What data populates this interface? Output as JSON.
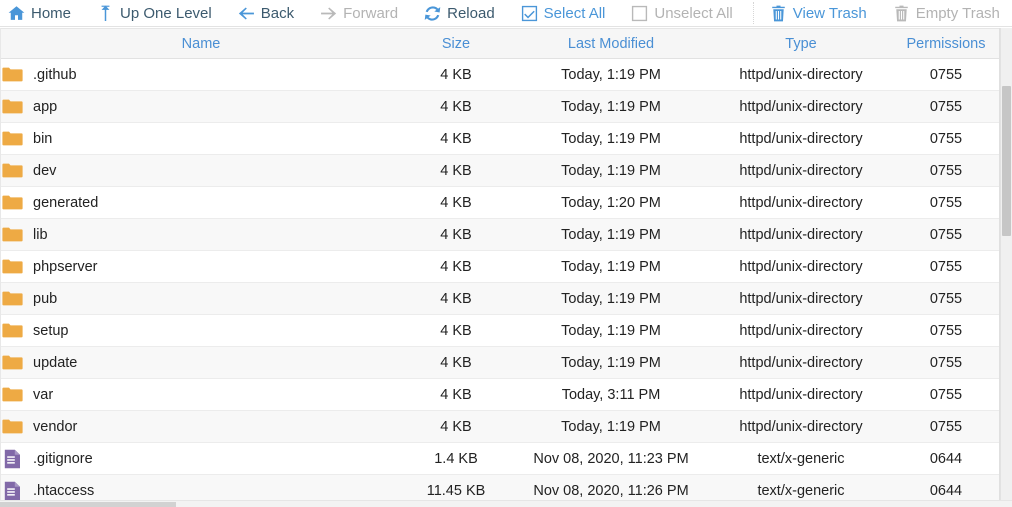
{
  "toolbar": {
    "items": [
      {
        "label": "Home",
        "icon": "home-icon",
        "state": "active"
      },
      {
        "label": "Up One Level",
        "icon": "arrow-up-icon",
        "state": "active"
      },
      {
        "label": "Back",
        "icon": "arrow-left-icon",
        "state": "active"
      },
      {
        "label": "Forward",
        "icon": "arrow-right-icon",
        "state": "disabled"
      },
      {
        "label": "Reload",
        "icon": "refresh-icon",
        "state": "active"
      },
      {
        "label": "Select All",
        "icon": "checkbox-checked-icon",
        "state": "linkblue"
      },
      {
        "label": "Unselect All",
        "icon": "checkbox-empty-icon",
        "state": "disabled"
      },
      {
        "label": "View Trash",
        "icon": "trash-icon",
        "state": "linkblue"
      },
      {
        "label": "Empty Trash",
        "icon": "trash-icon",
        "state": "disabled"
      }
    ],
    "divider_after_index": 6
  },
  "columns": [
    {
      "key": "name",
      "label": "Name"
    },
    {
      "key": "size",
      "label": "Size"
    },
    {
      "key": "modified",
      "label": "Last Modified"
    },
    {
      "key": "type",
      "label": "Type"
    },
    {
      "key": "permissions",
      "label": "Permissions"
    }
  ],
  "rows": [
    {
      "icon": "folder-icon",
      "name": ".github",
      "size": "4 KB",
      "modified": "Today, 1:19 PM",
      "type": "httpd/unix-directory",
      "permissions": "0755"
    },
    {
      "icon": "folder-icon",
      "name": "app",
      "size": "4 KB",
      "modified": "Today, 1:19 PM",
      "type": "httpd/unix-directory",
      "permissions": "0755"
    },
    {
      "icon": "folder-icon",
      "name": "bin",
      "size": "4 KB",
      "modified": "Today, 1:19 PM",
      "type": "httpd/unix-directory",
      "permissions": "0755"
    },
    {
      "icon": "folder-icon",
      "name": "dev",
      "size": "4 KB",
      "modified": "Today, 1:19 PM",
      "type": "httpd/unix-directory",
      "permissions": "0755"
    },
    {
      "icon": "folder-icon",
      "name": "generated",
      "size": "4 KB",
      "modified": "Today, 1:20 PM",
      "type": "httpd/unix-directory",
      "permissions": "0755"
    },
    {
      "icon": "folder-icon",
      "name": "lib",
      "size": "4 KB",
      "modified": "Today, 1:19 PM",
      "type": "httpd/unix-directory",
      "permissions": "0755"
    },
    {
      "icon": "folder-icon",
      "name": "phpserver",
      "size": "4 KB",
      "modified": "Today, 1:19 PM",
      "type": "httpd/unix-directory",
      "permissions": "0755"
    },
    {
      "icon": "folder-icon",
      "name": "pub",
      "size": "4 KB",
      "modified": "Today, 1:19 PM",
      "type": "httpd/unix-directory",
      "permissions": "0755"
    },
    {
      "icon": "folder-icon",
      "name": "setup",
      "size": "4 KB",
      "modified": "Today, 1:19 PM",
      "type": "httpd/unix-directory",
      "permissions": "0755"
    },
    {
      "icon": "folder-icon",
      "name": "update",
      "size": "4 KB",
      "modified": "Today, 1:19 PM",
      "type": "httpd/unix-directory",
      "permissions": "0755"
    },
    {
      "icon": "folder-icon",
      "name": "var",
      "size": "4 KB",
      "modified": "Today, 3:11 PM",
      "type": "httpd/unix-directory",
      "permissions": "0755"
    },
    {
      "icon": "folder-icon",
      "name": "vendor",
      "size": "4 KB",
      "modified": "Today, 1:19 PM",
      "type": "httpd/unix-directory",
      "permissions": "0755"
    },
    {
      "icon": "file-icon",
      "name": ".gitignore",
      "size": "1.4 KB",
      "modified": "Nov 08, 2020, 11:23 PM",
      "type": "text/x-generic",
      "permissions": "0644"
    },
    {
      "icon": "file-icon",
      "name": ".htaccess",
      "size": "11.45 KB",
      "modified": "Nov 08, 2020, 11:26 PM",
      "type": "text/x-generic",
      "permissions": "0644"
    }
  ],
  "colors": {
    "accent_blue": "#4a96d8",
    "folder_amber": "#eeaa44",
    "file_purple": "#8169a8",
    "disabled_gray": "#b3b3b3",
    "row_alt": "#f8f8f8"
  }
}
